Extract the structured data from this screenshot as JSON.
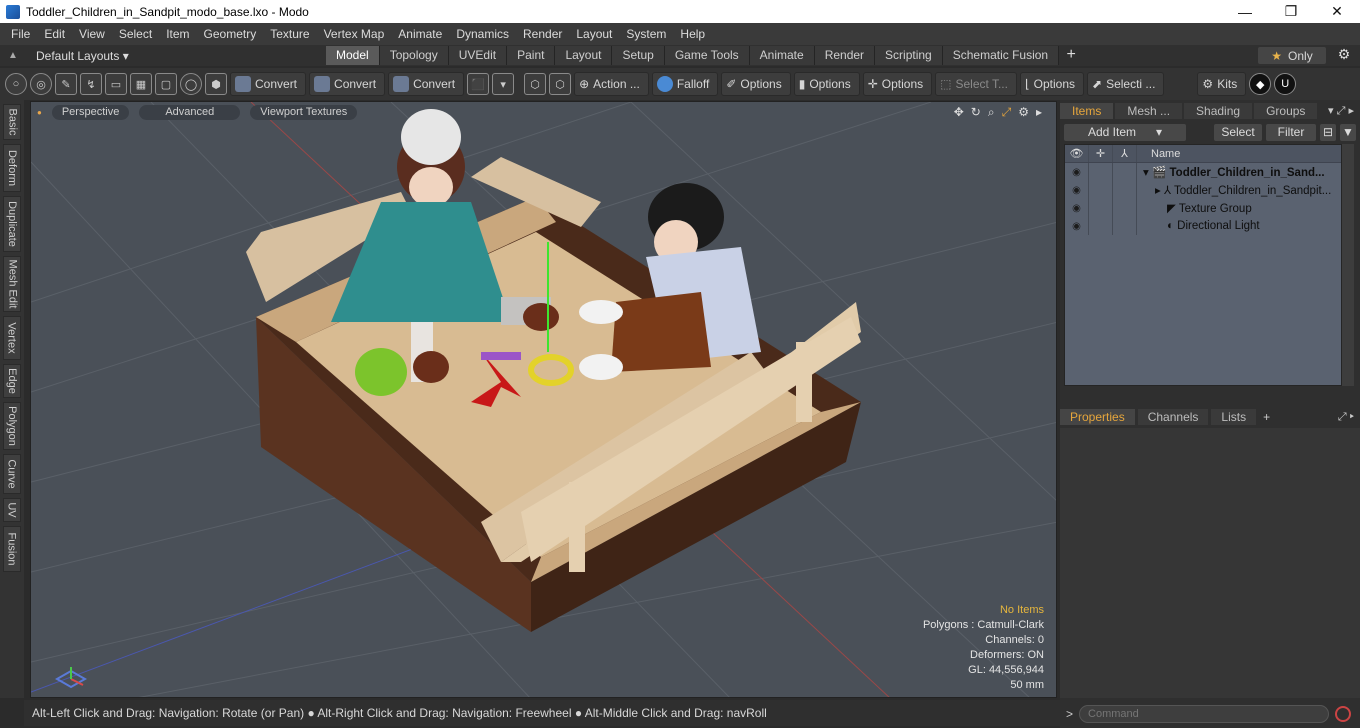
{
  "window": {
    "title": "Toddler_Children_in_Sandpit_modo_base.lxo - Modo",
    "minimize": "—",
    "maximize": "❐",
    "close": "✕"
  },
  "menu": [
    "File",
    "Edit",
    "View",
    "Select",
    "Item",
    "Geometry",
    "Texture",
    "Vertex Map",
    "Animate",
    "Dynamics",
    "Render",
    "Layout",
    "System",
    "Help"
  ],
  "layout": {
    "selector": "Default Layouts ▾",
    "tabs": [
      "Model",
      "Topology",
      "UVEdit",
      "Paint",
      "Layout",
      "Setup",
      "Game Tools",
      "Animate",
      "Render",
      "Scripting",
      "Schematic Fusion"
    ],
    "active_tab": "Model",
    "only_label": "Only"
  },
  "toolbar": {
    "convert1": "Convert",
    "convert2": "Convert",
    "convert3": "Convert",
    "action": "Action ...",
    "falloff": "Falloff",
    "options1": "Options",
    "options2": "Options",
    "options3": "Options",
    "select_t": "Select T...",
    "options4": "Options",
    "selecti": "Selecti ...",
    "kits": "Kits"
  },
  "left_tabs": [
    "Basic",
    "Deform",
    "Duplicate",
    "Mesh Edit",
    "Vertex",
    "Edge",
    "Polygon",
    "Curve",
    "UV",
    "Fusion"
  ],
  "viewport": {
    "view_mode": "Perspective",
    "shading": "Advanced",
    "textures": "Viewport Textures",
    "info": {
      "no_items": "No Items",
      "polygons": "Polygons : Catmull-Clark",
      "channels": "Channels: 0",
      "deformers": "Deformers: ON",
      "gl": "GL: 44,556,944",
      "scale": "50 mm"
    }
  },
  "status": "Alt-Left Click and Drag: Navigation: Rotate (or Pan) ● Alt-Right Click and Drag: Navigation: Freewheel ● Alt-Middle Click and Drag: navRoll",
  "right_panel": {
    "tabs": [
      "Items",
      "Mesh ...",
      "Shading",
      "Groups"
    ],
    "active_tab": "Items",
    "add_item": "Add Item",
    "select": "Select",
    "filter": "Filter",
    "column_name": "Name",
    "tree": [
      {
        "label": "Toddler_Children_in_Sand...",
        "bold": true
      },
      {
        "label": "Toddler_Children_in_Sandpit...",
        "bold": false
      },
      {
        "label": "Texture Group",
        "bold": false
      },
      {
        "label": "Directional Light",
        "bold": false
      }
    ],
    "props_tabs": [
      "Properties",
      "Channels",
      "Lists"
    ],
    "command_placeholder": "Command"
  }
}
